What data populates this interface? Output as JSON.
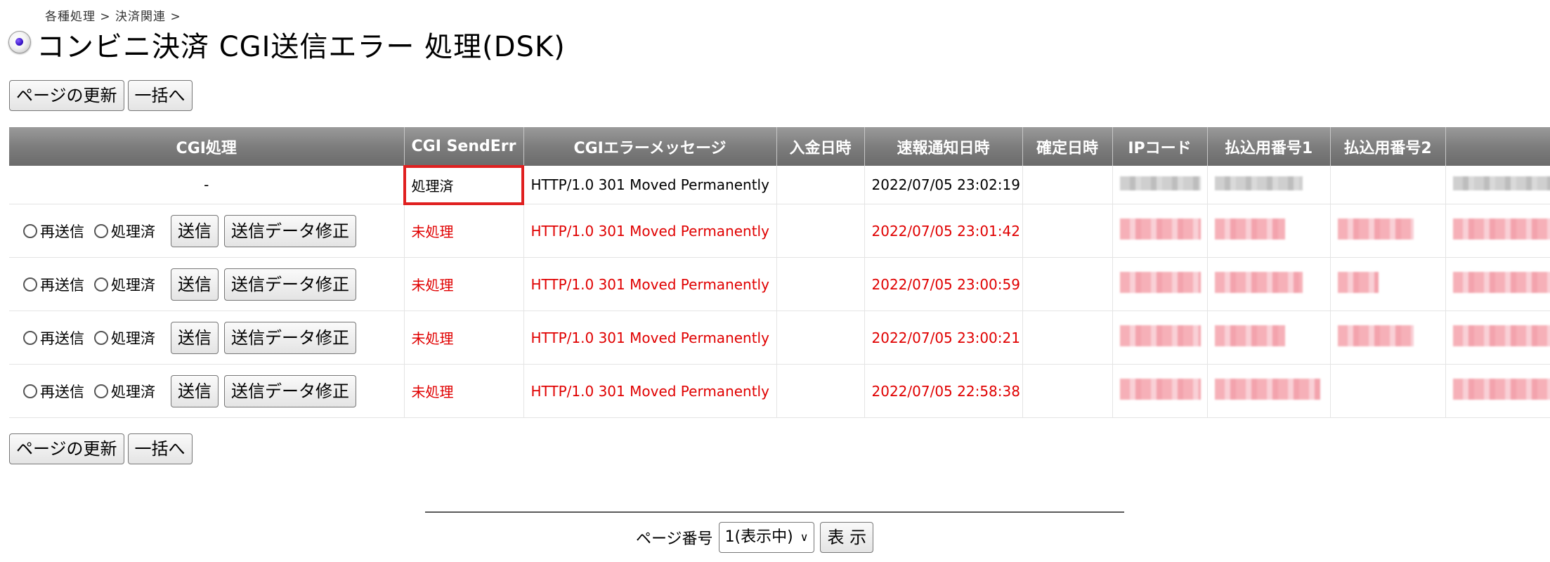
{
  "breadcrumb": "各種処理 > 決済関連 >",
  "page_title": "コンビニ決済 CGI送信エラー 処理(DSK)",
  "buttons": {
    "refresh": "ページの更新",
    "bulk": "一括へ"
  },
  "table": {
    "headers": [
      "CGI処理",
      "CGI SendErr",
      "CGIエラーメッセージ",
      "入金日時",
      "速報通知日時",
      "確定日時",
      "IPコード",
      "払込用番号1",
      "払込用番号2",
      ""
    ],
    "first_row": {
      "cgi_action": "-",
      "send_err": "処理済",
      "message": "HTTP/1.0 301 Moved Permanently",
      "notify": "2022/07/05 23:02:19"
    },
    "row_controls": {
      "resend": "再送信",
      "processed": "処理済",
      "send": "送信",
      "edit": "送信データ修正"
    },
    "rows": [
      {
        "send_err": "未処理",
        "message": "HTTP/1.0 301 Moved Permanently",
        "notify": "2022/07/05 23:01:42"
      },
      {
        "send_err": "未処理",
        "message": "HTTP/1.0 301 Moved Permanently",
        "notify": "2022/07/05 23:00:59"
      },
      {
        "send_err": "未処理",
        "message": "HTTP/1.0 301 Moved Permanently",
        "notify": "2022/07/05 23:00:21"
      },
      {
        "send_err": "未処理",
        "message": "HTTP/1.0 301 Moved Permanently",
        "notify": "2022/07/05 22:58:38"
      }
    ]
  },
  "pager": {
    "label": "ページ番号",
    "selected": "1(表示中)",
    "show": "表 示"
  },
  "colors": {
    "error_red": "#e00000",
    "highlight": "#e02020",
    "header_gray": "#7d7d7d"
  },
  "icons": {
    "title": "radio-bullet-icon",
    "select": "chevron-down-icon"
  }
}
